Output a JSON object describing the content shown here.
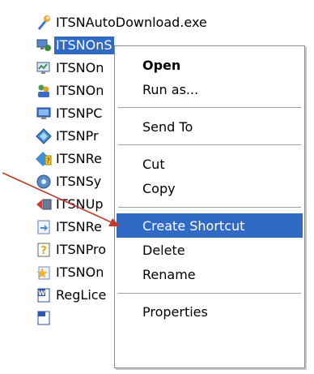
{
  "files": [
    {
      "name": "ITSNAutoDownload.exe",
      "icon": "wrench-app-icon",
      "selected": false
    },
    {
      "name": "ITSNOnS",
      "icon": "computer-network-icon",
      "selected": true
    },
    {
      "name": "ITSNOn",
      "icon": "monitor-chart-icon",
      "selected": false
    },
    {
      "name": "ITSNOn",
      "icon": "people-network-icon",
      "selected": false
    },
    {
      "name": "ITSNPC",
      "icon": "monitor-icon",
      "selected": false
    },
    {
      "name": "ITSNPr",
      "icon": "diamond-shield-icon",
      "selected": false
    },
    {
      "name": "ITSNRe",
      "icon": "question-diamond-icon",
      "selected": false
    },
    {
      "name": "ITSNSy",
      "icon": "disk-icon",
      "selected": false
    },
    {
      "name": "ITSNUp",
      "icon": "update-icon",
      "selected": false
    },
    {
      "name": "ITSNRe",
      "icon": "document-arrow-icon",
      "selected": false
    },
    {
      "name": "ITSNPro",
      "icon": "help-document-icon",
      "selected": false
    },
    {
      "name": "ITSNOn",
      "icon": "document-star-icon",
      "selected": false
    },
    {
      "name": "RegLice",
      "icon": "word-document-icon",
      "selected": false
    }
  ],
  "menu": {
    "items": [
      {
        "label": "Open",
        "bold": true,
        "highlighted": false
      },
      {
        "label": "Run as...",
        "bold": false,
        "highlighted": false
      },
      {
        "label": "Send To",
        "bold": false,
        "highlighted": false
      },
      {
        "label": "Cut",
        "bold": false,
        "highlighted": false
      },
      {
        "label": "Copy",
        "bold": false,
        "highlighted": false
      },
      {
        "label": "Create Shortcut",
        "bold": false,
        "highlighted": true
      },
      {
        "label": "Delete",
        "bold": false,
        "highlighted": false
      },
      {
        "label": "Rename",
        "bold": false,
        "highlighted": false
      },
      {
        "label": "Properties",
        "bold": false,
        "highlighted": false
      }
    ]
  },
  "colors": {
    "selection": "#316ac5",
    "arrow": "#c0392b"
  }
}
